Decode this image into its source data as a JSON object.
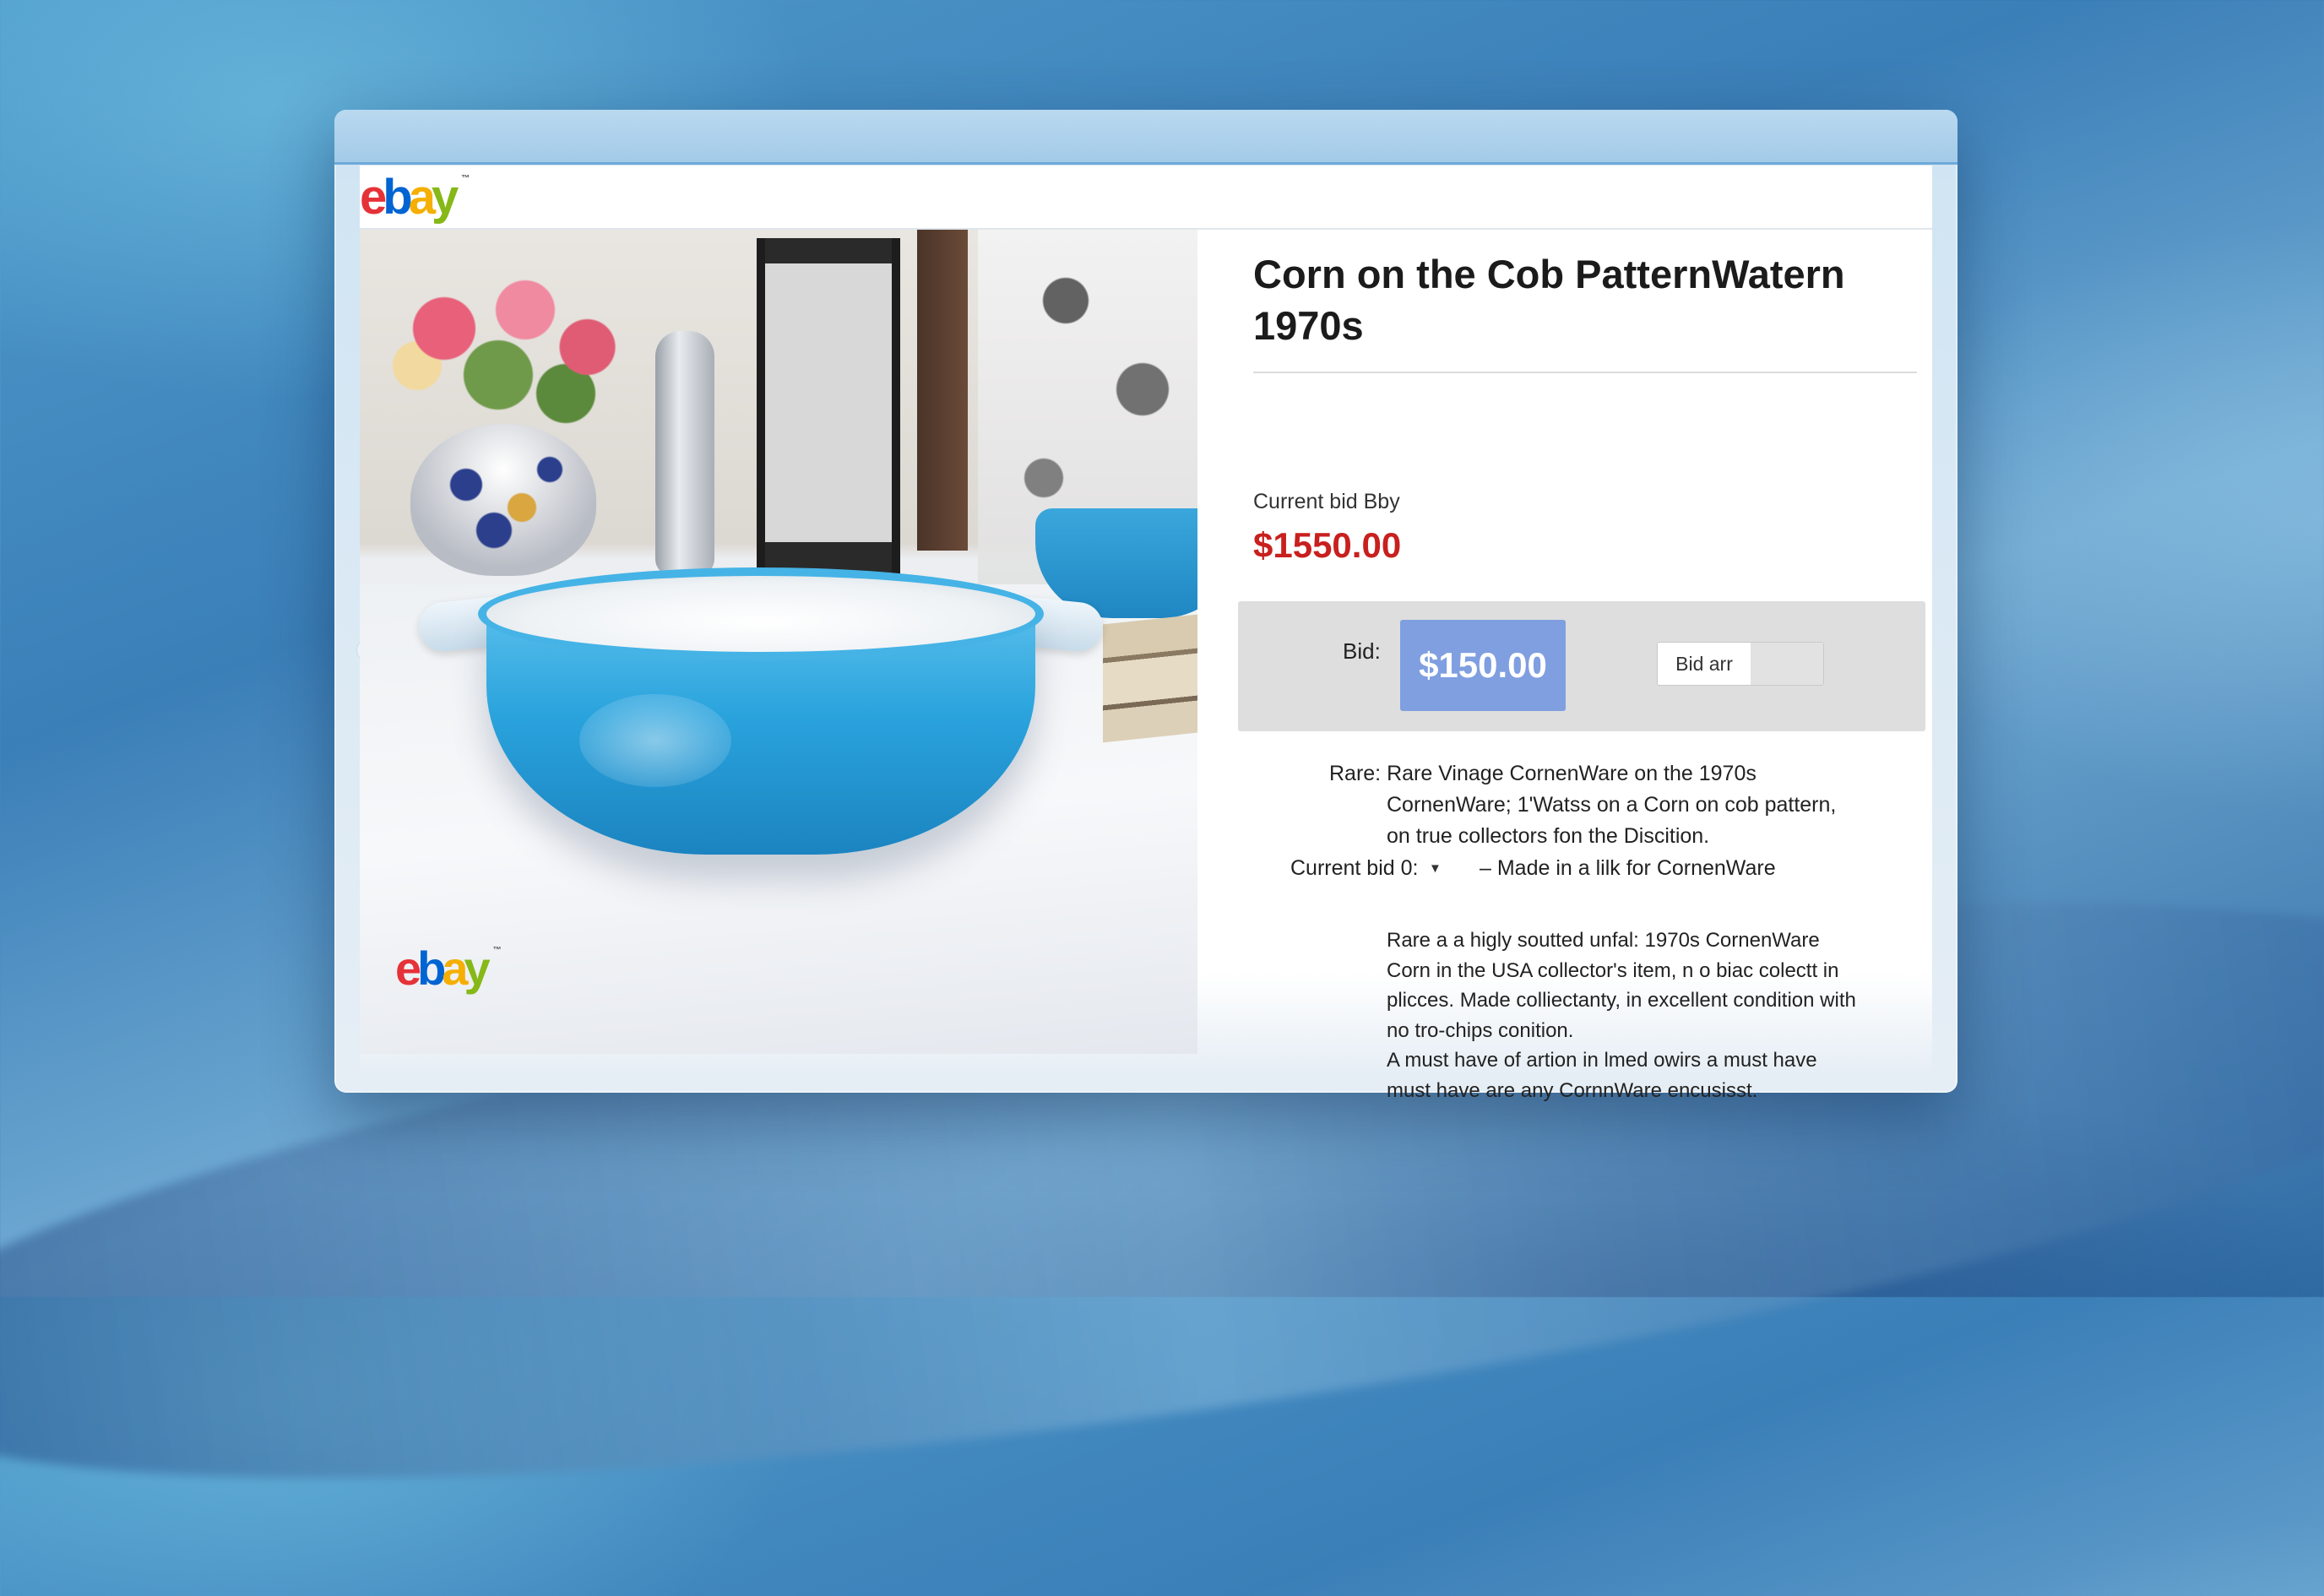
{
  "browser": {
    "logo": [
      "e",
      "b",
      "a",
      "y"
    ],
    "trademark": "™"
  },
  "photo": {
    "watermark_logo": [
      "e",
      "b",
      "a",
      "y"
    ],
    "trademark": "™"
  },
  "listing": {
    "title_line1": "Corn on the Cob PatternWatern",
    "title_line2": "1970s",
    "current_bid_label": "Current bid Bby",
    "current_bid_value": "$1550.00",
    "price_color": "#c8201e"
  },
  "bid_panel": {
    "label": "Bid:",
    "amount": "$150.00",
    "button_label": "Bid arr"
  },
  "description": {
    "line1": "Rare:  Rare Vinage CornenWare on the 1970s",
    "line2": "CornenWare; 1'Watss on a Corn on cob pattern,",
    "line3": "on true collectors fon the Discition.",
    "current_bid_select": "Current bid 0:",
    "made_line": "– Made in a lilk for CornenWare",
    "paragraph": [
      "Rare a a higly soutted unfal: 1970s CornenWare",
      "Corn in the USA collector's item, n o biac colectt in",
      "plicces. Made colliectanty, in excellent condition with",
      "no tro-chips conition.",
      "A must have  of artion in lmed owirs a must have",
      "must have are any CornnWare encusisst."
    ]
  },
  "icons": {
    "window_controls": [
      "window-dot-icon",
      "window-dot-icon"
    ],
    "select_caret": "caret-down-icon"
  },
  "colors": {
    "accent_blue": "#7f9fe0",
    "ebay_red": "#e53238",
    "ebay_blue": "#0064d2",
    "ebay_yellow": "#f5af02",
    "ebay_green": "#86b817"
  }
}
